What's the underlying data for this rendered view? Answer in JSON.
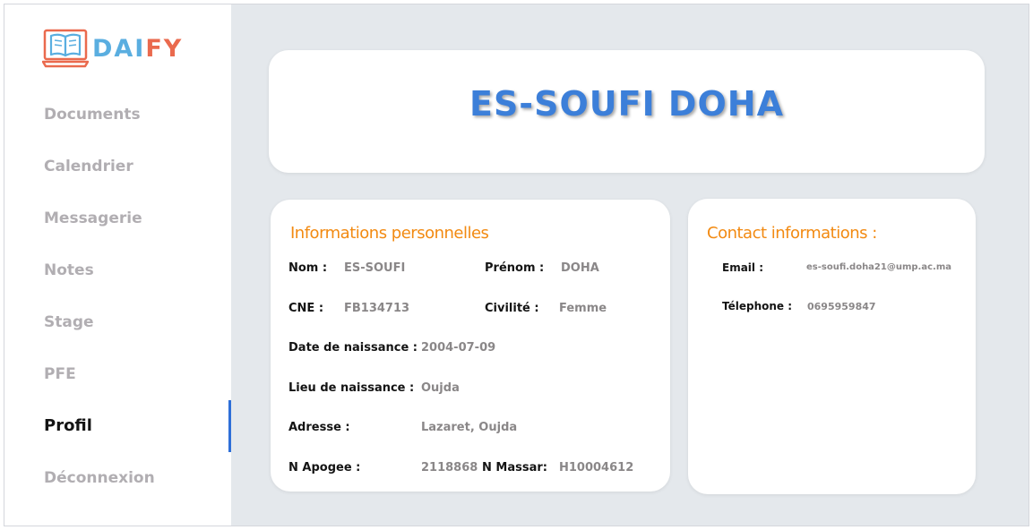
{
  "app": {
    "logo_part1": "DAI",
    "logo_part2": "FY",
    "logo_icon": "book-monitor-icon",
    "colors": {
      "logo_blue": "#5aaee0",
      "logo_orange": "#ea6a4e",
      "accent": "#2e6fd8",
      "heading_orange": "#f28a12",
      "name_blue": "#3c7fd9"
    }
  },
  "sidebar": {
    "items": [
      {
        "label": "Documents",
        "active": false
      },
      {
        "label": "Calendrier",
        "active": false
      },
      {
        "label": "Messagerie",
        "active": false
      },
      {
        "label": "Notes",
        "active": false
      },
      {
        "label": "Stage",
        "active": false
      },
      {
        "label": "PFE",
        "active": false
      },
      {
        "label": "Profil",
        "active": true
      },
      {
        "label": "Déconnexion",
        "active": false
      }
    ]
  },
  "profile": {
    "full_name": "ES-SOUFI DOHA"
  },
  "personal": {
    "heading": "Informations personnelles",
    "nom_label": "Nom :",
    "nom_value": "ES-SOUFI",
    "prenom_label": "Prénom :",
    "prenom_value": "DOHA",
    "cne_label": "CNE :",
    "cne_value": "FB134713",
    "civilite_label": "Civilité :",
    "civilite_value": "Femme",
    "birthdate_label": "Date de naissance :",
    "birthdate_value": "2004-07-09",
    "birthplace_label": "Lieu de naissance :",
    "birthplace_value": "Oujda",
    "address_label": "Adresse :",
    "address_value": "Lazaret, Oujda",
    "apogee_label": "N Apogee :",
    "apogee_value": "2118868",
    "massar_label": "N Massar:",
    "massar_value": "H10004612"
  },
  "contact": {
    "heading": "Contact informations :",
    "email_label": "Email :",
    "email_value": "es-soufi.doha21@ump.ac.ma",
    "phone_label": "Télephone :",
    "phone_value": "0695959847"
  }
}
